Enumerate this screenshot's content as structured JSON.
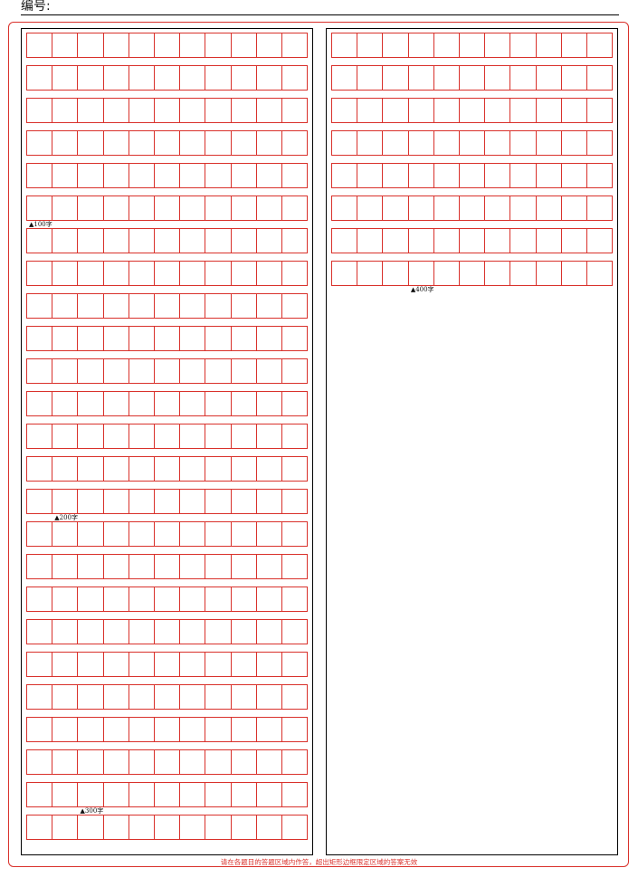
{
  "header": {
    "label": "编号:"
  },
  "grid": {
    "columns": 11,
    "left_rows": 25,
    "right_rows": 8
  },
  "markers": [
    {
      "text": "▲100字",
      "column": "left",
      "after_row": 6,
      "cell": 0
    },
    {
      "text": "▲200字",
      "column": "left",
      "after_row": 15,
      "cell": 1
    },
    {
      "text": "▲300字",
      "column": "left",
      "after_row": 24,
      "cell": 2
    },
    {
      "text": "▲400字",
      "column": "right",
      "after_row": 8,
      "cell": 3
    }
  ],
  "footer": {
    "notice": "请在各题目的答题区域内作答，超出矩形边框限定区域的答案无效"
  },
  "colors": {
    "grid_red": "#d9312b",
    "frame_black": "#000000"
  }
}
